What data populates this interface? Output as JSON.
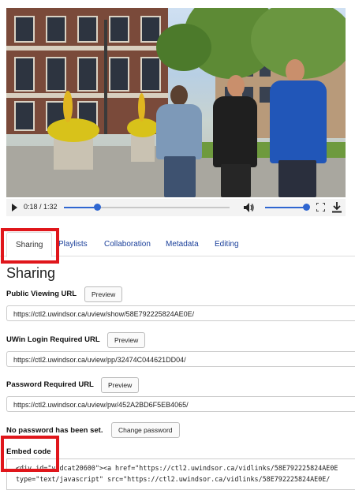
{
  "player": {
    "time": "0:18 / 1:32",
    "progress_fraction": 0.2,
    "volume_fraction": 1.0
  },
  "tabs": [
    {
      "label": "Sharing"
    },
    {
      "label": "Playlists"
    },
    {
      "label": "Collaboration"
    },
    {
      "label": "Metadata"
    },
    {
      "label": "Editing"
    }
  ],
  "sharing": {
    "heading": "Sharing",
    "public": {
      "label": "Public Viewing URL",
      "button": "Preview",
      "url": "https://ctl2.uwindsor.ca/uview/show/58E792225824AE0E/"
    },
    "uwin": {
      "label": "UWin Login Required URL",
      "button": "Preview",
      "url": "https://ctl2.uwindsor.ca/uview/pp/32474C044621DD04/"
    },
    "password": {
      "label": "Password Required URL",
      "button": "Preview",
      "url": "https://ctl2.uwindsor.ca/uview/pw/452A2BD6F5EB4065/"
    },
    "no_password_text": "No password has been set.",
    "change_password_button": "Change password",
    "embed": {
      "label": "Embed code",
      "line1": "<div id=\"vidcat20600\"><a href=\"https://ctl2.uwindsor.ca/vidlinks/58E792225824AE0E",
      "line2": "type=\"text/javascript\" src=\"https://ctl2.uwindsor.ca/vidlinks/58E792225824AE0E/"
    }
  },
  "colors": {
    "link": "#1a3f9a",
    "highlight": "#e0161b",
    "slider": "#2f66d0"
  }
}
